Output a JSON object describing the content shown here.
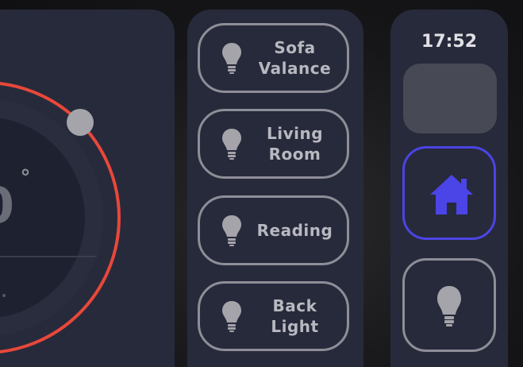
{
  "thermostat": {
    "temperature_fragment": "0",
    "degree_symbol": "°",
    "ring_color": "#e8483a"
  },
  "lights": {
    "items": [
      {
        "label_line1": "Sofa",
        "label_line2": "Valance",
        "icon": "lightbulb-icon"
      },
      {
        "label_line1": "Living",
        "label_line2": "Room",
        "icon": "lightbulb-icon"
      },
      {
        "label_line1": "Reading",
        "label_line2": "",
        "icon": "lightbulb-icon"
      },
      {
        "label_line1": "Back",
        "label_line2": "Light",
        "icon": "lightbulb-icon"
      }
    ]
  },
  "nav": {
    "clock": "17:52",
    "home_icon": "home-icon",
    "light_icon": "lightbulb-icon",
    "accent_color": "#4b44e6"
  }
}
